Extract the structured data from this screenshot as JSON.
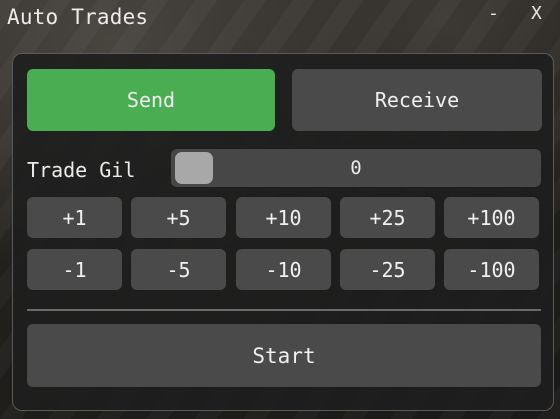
{
  "window": {
    "title": "Auto Trades",
    "minimize_label": "-",
    "close_label": "X"
  },
  "mode": {
    "send_label": "Send",
    "receive_label": "Receive",
    "selected": "Send",
    "accent_color": "#4aad51"
  },
  "trade_gil": {
    "label": "Trade Gil",
    "value": "0"
  },
  "increments": [
    "+1",
    "+5",
    "+10",
    "+25",
    "+100"
  ],
  "decrements": [
    "-1",
    "-5",
    "-10",
    "-25",
    "-100"
  ],
  "start_label": "Start"
}
